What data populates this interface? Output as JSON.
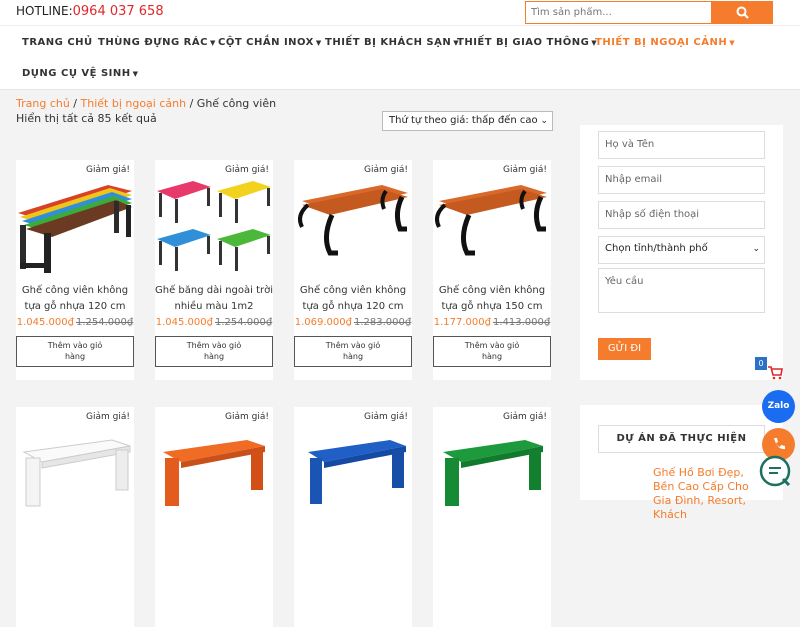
{
  "header": {
    "hotline_label": "HOTLINE:",
    "hotline_number": "0964 037 658",
    "search_placeholder": "Tìm sản phẩm..."
  },
  "nav": {
    "items": [
      {
        "label": "TRANG CHỦ"
      },
      {
        "label": "THÙNG ĐỰNG RÁC"
      },
      {
        "label": "CỘT CHẮN INOX"
      },
      {
        "label": "THIẾT BỊ KHÁCH SẠN"
      },
      {
        "label": "THIẾT BỊ GIAO THÔNG"
      },
      {
        "label": "THIẾT BỊ NGOẠI CẢNH"
      },
      {
        "label": "DỤNG CỤ VỆ SINH"
      }
    ]
  },
  "breadcrumb": {
    "home": "Trang chủ",
    "sep": " / ",
    "category": "Thiết bị ngoại cảnh",
    "current": "Ghế công viên"
  },
  "results": {
    "count_text": "Hiển thị tất cả 85 kết quả"
  },
  "sort": {
    "selected": "Thứ tự theo giá: thấp đến cao"
  },
  "products": [
    {
      "sale": "Giảm giá!",
      "name": "Ghế công viên không tựa gỗ nhựa 120 cm",
      "price": "1.045.000₫",
      "old_price": "1.254.000₫",
      "cart": "Thêm vào giỏ hàng"
    },
    {
      "sale": "Giảm giá!",
      "name": "Ghế băng dài ngoài trời nhiều màu 1m2",
      "price": "1.045.000₫",
      "old_price": "1.254.000₫",
      "cart": "Thêm vào giỏ hàng"
    },
    {
      "sale": "Giảm giá!",
      "name": "Ghế công viên không tựa gỗ nhựa 120 cm",
      "price": "1.069.000₫",
      "old_price": "1.283.000₫",
      "cart": "Thêm vào giỏ hàng"
    },
    {
      "sale": "Giảm giá!",
      "name": "Ghế công viên không tựa gỗ nhựa 150 cm",
      "price": "1.177.000₫",
      "old_price": "1.413.000₫",
      "cart": "Thêm vào giỏ hàng"
    },
    {
      "sale": "Giảm giá!"
    },
    {
      "sale": "Giảm giá!"
    },
    {
      "sale": "Giảm giá!"
    },
    {
      "sale": "Giảm giá!"
    }
  ],
  "form": {
    "name_placeholder": "Họ và Tên",
    "email_placeholder": "Nhập email",
    "phone_placeholder": "Nhập số điện thoại",
    "city_selected": "Chọn tỉnh/thành phố",
    "request_placeholder": "Yêu cầu",
    "submit": "GỬI ĐI"
  },
  "projects": {
    "title": "DỰ ÁN ĐÃ THỰC HIỆN",
    "link": "Ghế Hồ Bơi Đẹp, Bền Cao Cấp Cho Gia Đình, Resort, Khách"
  },
  "widgets": {
    "cart_count": "0",
    "zalo": "Zalo"
  },
  "colors": {
    "accent": "#f47c2c",
    "hotline": "#e0272a",
    "zalo": "#1a6cf0"
  }
}
